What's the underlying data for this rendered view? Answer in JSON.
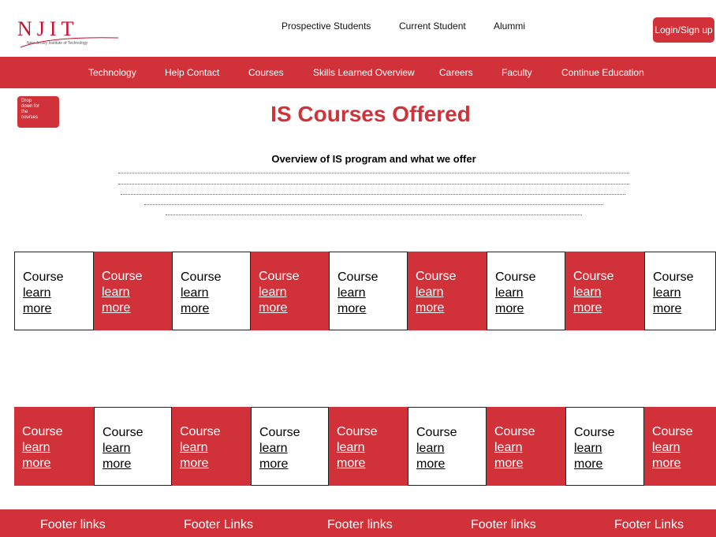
{
  "logo": {
    "text": "NJIT",
    "subtitle": "New Jersey Institute of Technology"
  },
  "top_links": [
    {
      "label": "Prospective Students"
    },
    {
      "label": "Current Student"
    },
    {
      "label": "Alummi"
    }
  ],
  "login_label": "Login/Sign up",
  "nav": [
    {
      "label": "Technology"
    },
    {
      "label": "Help Contact"
    },
    {
      "label": "Courses"
    },
    {
      "label": "Skills Learned Overview"
    },
    {
      "label": "Careers"
    },
    {
      "label": "Faculty"
    },
    {
      "label": "Continue Education"
    }
  ],
  "dropdown_lines": [
    "Drop",
    "down for",
    "the",
    "courses"
  ],
  "page_title": "IS Courses Offered",
  "overview_heading": "Overview of IS program and what we offer",
  "course_rows": [
    [
      {
        "title": "Course",
        "link": [
          "learn",
          "more"
        ]
      },
      {
        "title": "Course",
        "link": [
          "learn",
          "more"
        ]
      },
      {
        "title": "Course",
        "link": [
          "learn",
          "more"
        ]
      },
      {
        "title": "Course",
        "link": [
          "learn",
          "more"
        ]
      },
      {
        "title": "Course",
        "link": [
          "learn",
          "more"
        ]
      },
      {
        "title": "Course",
        "link": [
          "learn",
          "more"
        ]
      },
      {
        "title": "Course",
        "link": [
          "learn",
          "more"
        ]
      },
      {
        "title": "Course",
        "link": [
          "learn",
          "more"
        ]
      },
      {
        "title": "Course",
        "link": [
          "learn",
          "more"
        ]
      }
    ],
    [
      {
        "title": "Course",
        "link": [
          "learn",
          "more"
        ]
      },
      {
        "title": "Course",
        "link": [
          "learn",
          "more"
        ]
      },
      {
        "title": "Course",
        "link": [
          "learn",
          "more"
        ]
      },
      {
        "title": "Course",
        "link": [
          "learn",
          "more"
        ]
      },
      {
        "title": "Course",
        "link": [
          "learn",
          "more"
        ]
      },
      {
        "title": "Course",
        "link": [
          "learn",
          "more"
        ]
      },
      {
        "title": "Course",
        "link": [
          "learn",
          "more"
        ]
      },
      {
        "title": "Course",
        "link": [
          "learn",
          "more"
        ]
      },
      {
        "title": "Course",
        "link": [
          "learn",
          "more"
        ]
      }
    ]
  ],
  "footer_links": [
    {
      "label": "Footer links"
    },
    {
      "label": "Footer Links"
    },
    {
      "label": "Footer links"
    },
    {
      "label": "Footer links"
    },
    {
      "label": "Footer Links"
    }
  ],
  "colors": {
    "accent": "#d1323a",
    "background": "#ffffff",
    "card_border": "#222222"
  }
}
